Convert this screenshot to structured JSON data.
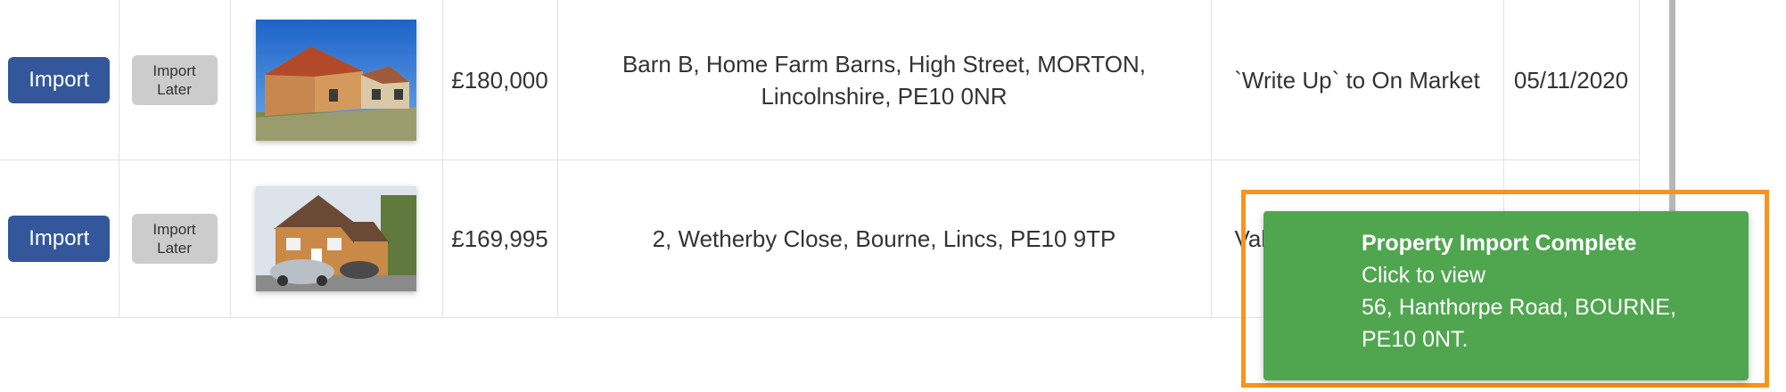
{
  "rows": [
    {
      "import_label": "Import",
      "import_later_label": "Import\nLater",
      "photo_icon": "house-photo",
      "price": "£180,000",
      "address": "Barn B, Home Farm Barns, High Street, MORTON, Lincolnshire, PE10 0NR",
      "status": "`Write Up` to On Market",
      "date": "05/11/2020"
    },
    {
      "import_label": "Import",
      "import_later_label": "Import\nLater",
      "photo_icon": "house-photo",
      "price": "£169,995",
      "address": "2, Wetherby Close, Bourne, Lincs, PE10 9TP",
      "status": "Val",
      "date": ""
    }
  ],
  "toast": {
    "title": "Property Import Complete",
    "subtitle": "Click to view",
    "address_line1": "56, Hanthorpe Road, BOURNE,",
    "address_line2": "PE10 0NT."
  },
  "colors": {
    "import_button": "#34579b",
    "import_later_button": "#cccccc",
    "toast_background": "#4fa64f",
    "highlight_border": "#f7931e"
  }
}
